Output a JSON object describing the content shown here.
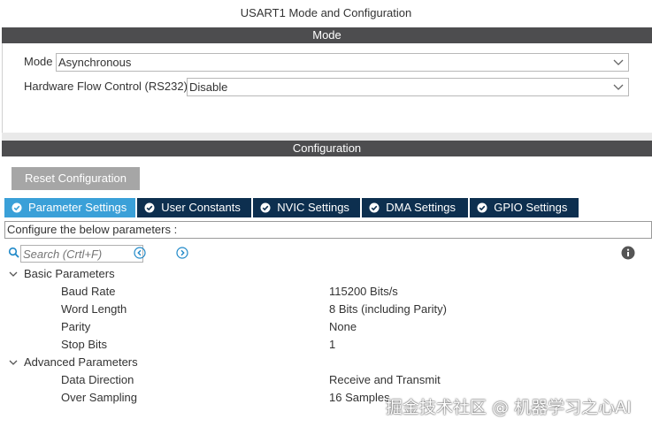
{
  "window": {
    "title": "USART1 Mode and Configuration"
  },
  "mode_section": {
    "header": "Mode",
    "mode_label": "Mode",
    "mode_value": "Asynchronous",
    "flow_label": "Hardware Flow Control (RS232)",
    "flow_value": "Disable"
  },
  "config_section": {
    "header": "Configuration",
    "reset_label": "Reset Configuration",
    "tabs": [
      {
        "label": "Parameter Settings",
        "active": true
      },
      {
        "label": "User Constants",
        "active": false
      },
      {
        "label": "NVIC Settings",
        "active": false
      },
      {
        "label": "DMA Settings",
        "active": false
      },
      {
        "label": "GPIO Settings",
        "active": false
      }
    ],
    "instruction": "Configure the below parameters :",
    "search_placeholder": "Search (Crtl+F)"
  },
  "params": {
    "basic": {
      "label": "Basic Parameters",
      "items": [
        {
          "name": "Baud Rate",
          "value": "115200 Bits/s"
        },
        {
          "name": "Word Length",
          "value": "8 Bits (including Parity)"
        },
        {
          "name": "Parity",
          "value": "None"
        },
        {
          "name": "Stop Bits",
          "value": "1"
        }
      ]
    },
    "advanced": {
      "label": "Advanced Parameters",
      "items": [
        {
          "name": "Data Direction",
          "value": "Receive and Transmit"
        },
        {
          "name": "Over Sampling",
          "value": "16 Samples"
        }
      ]
    }
  },
  "watermark": "掘金技术社区 @ 机器学习之心AI",
  "colors": {
    "section_bar": "#4d4d4f",
    "tab_active": "#3aa0d8",
    "tab_inactive": "#0d2f4f",
    "button_gray": "#a6a6a6",
    "icon_blue": "#1e88c8"
  }
}
